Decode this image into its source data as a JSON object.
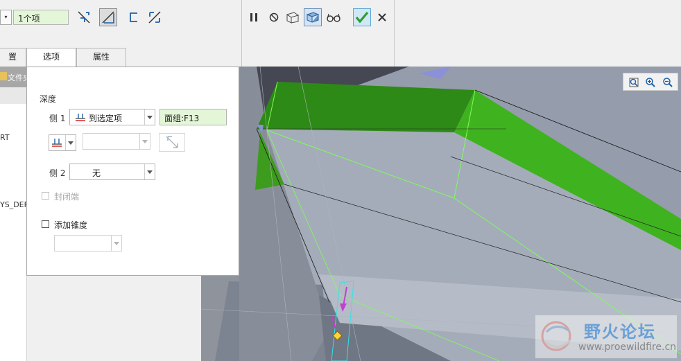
{
  "dashboard": {
    "collector_value": "1个项",
    "tabs": [
      {
        "label": "放置",
        "visible_fragment": "置"
      },
      {
        "label": "选项"
      },
      {
        "label": "属性"
      }
    ],
    "icons": [
      "flip-direction-icon",
      "depth-option-icon",
      "surface-icon",
      "thicken-icon",
      "pause-icon",
      "no-preview-icon",
      "attach-geometry-icon",
      "verify-preview-icon",
      "glasses-preview-icon",
      "ok-check-icon",
      "cancel-x-icon"
    ]
  },
  "model_tree": {
    "header_fragment": "文件夹",
    "items_visible": [
      "RT",
      "YS_DEF"
    ]
  },
  "options": {
    "depth_label": "深度",
    "side1_label": "侧 1",
    "side1_value": "到选定项",
    "side1_reference": "面组:F13",
    "side2_label": "侧 2",
    "side2_value": "无",
    "capped_ends_label": "封闭端",
    "add_taper_label": "添加锥度"
  },
  "watermark": {
    "title": "野火论坛",
    "url": "www.proewildfire.cn"
  },
  "colors": {
    "selection_green": "#3fa51e",
    "reference_field_bg": "#e4f6d8",
    "model_gray": "#9aa3b1",
    "viewport_bg": "#454852",
    "accent_check": "#2e9d2e"
  }
}
